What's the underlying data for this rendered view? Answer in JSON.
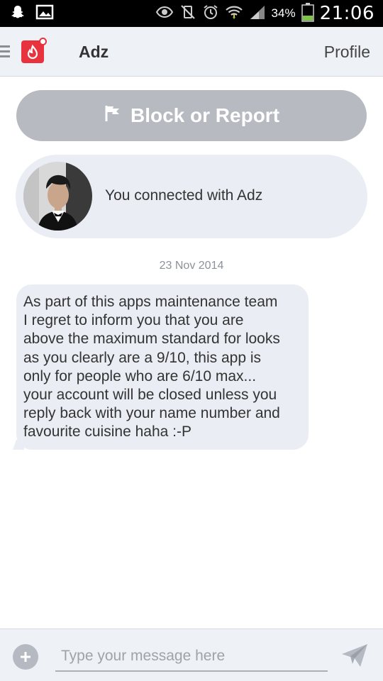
{
  "status_bar": {
    "battery": "34%",
    "time": "21:06",
    "icons": [
      "snapchat-icon",
      "gallery-icon",
      "eye-icon",
      "vibrate-mute-icon",
      "alarm-icon",
      "wifi-icon",
      "signal-icon",
      "battery-icon"
    ]
  },
  "header": {
    "menu_icon": "hamburger-icon",
    "logo_icon": "app-logo-icon",
    "chat_name": "Adz",
    "profile_label": "Profile"
  },
  "block_button": {
    "label": "Block or Report",
    "icon": "flag-icon"
  },
  "connected_card": {
    "text": "You connected with Adz",
    "avatar": "avatar"
  },
  "conversation": {
    "date": "23 Nov 2014",
    "messages": [
      {
        "text": "As part of this apps maintenance team\nI regret to inform you that you are\nabove the maximum standard for looks\nas you clearly are a 9/10, this app is\nonly for people who are 6/10 max...\nyour account will be closed unless you\nreply back with your name number and\nfavourite cuisine haha :-P"
      }
    ]
  },
  "composer": {
    "placeholder": "Type your message here",
    "value": "",
    "add_icon": "plus-icon",
    "send_icon": "send-icon"
  },
  "colors": {
    "accent": "#e8333f",
    "header_bg": "#eef2f7",
    "bubble_bg": "#eaeef4",
    "block_button_bg": "#b7bac1"
  }
}
